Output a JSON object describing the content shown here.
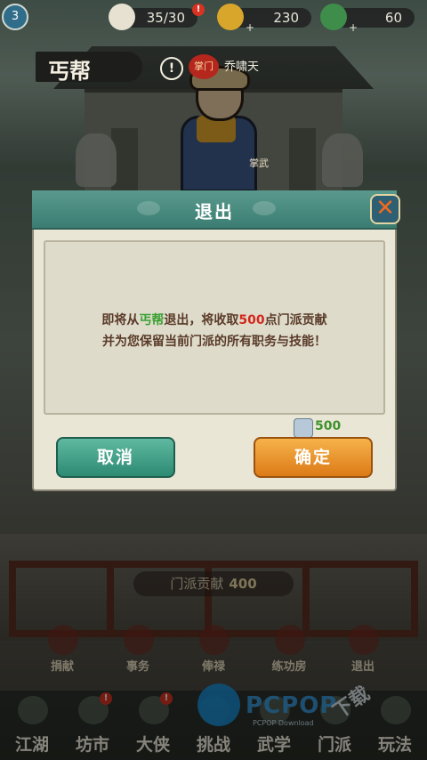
{
  "topbar": {
    "level": "3",
    "stamina": "35/30",
    "stamina_alert": "!",
    "gold": "230",
    "jade": "60"
  },
  "sect": {
    "name": "丐帮",
    "info": "!",
    "rank_badge": "掌门",
    "leader": "乔啸天",
    "hero_tag": "掌武"
  },
  "dialog": {
    "title": "退出",
    "msg_pre": "即将从",
    "msg_sect": "丐帮",
    "msg_mid": "退出，将收取",
    "msg_amount": "500",
    "msg_post": "点门派贡献",
    "msg_line2": "并为您保留当前门派的所有职务与技能！",
    "reward_value": "500",
    "cancel_label": "取消",
    "confirm_label": "确定"
  },
  "contribution": {
    "label": "门派贡献",
    "value": "400"
  },
  "functions": [
    "捐献",
    "事务",
    "俸禄",
    "练功房",
    "退出"
  ],
  "nav": {
    "items": [
      "江湖",
      "坊市",
      "大侠",
      "挑战",
      "武学",
      "门派",
      "玩法"
    ],
    "alerts": [
      "!",
      "!"
    ]
  },
  "watermark": {
    "brand": "PCPOP",
    "sub": "PCPOP Download",
    "cn": "下载"
  },
  "colors": {
    "accent_green": "#3aa030",
    "accent_red": "#d4281c",
    "confirm": "#dc7b17",
    "cancel": "#2d8a73"
  }
}
